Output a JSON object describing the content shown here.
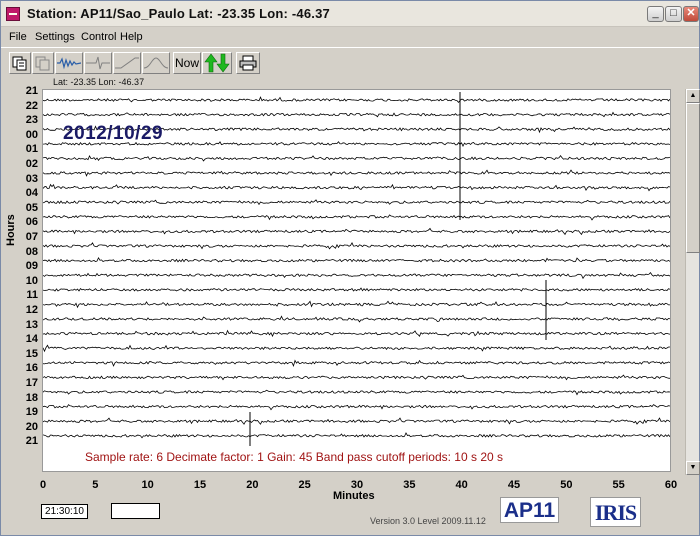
{
  "window": {
    "title": "Station: AP11/Sao_Paulo Lat: -23.35 Lon: -46.37",
    "min_symbol": "_",
    "max_symbol": "□",
    "close_symbol": "✕"
  },
  "menu": [
    "File",
    "Settings",
    "Control",
    "Help"
  ],
  "toolbar": {
    "buttons": [
      {
        "name": "copy-icon"
      },
      {
        "name": "paste-icon"
      },
      {
        "name": "waveform-icon"
      },
      {
        "name": "spike-icon"
      },
      {
        "name": "ramp-icon"
      },
      {
        "name": "filter-curve-icon"
      },
      {
        "name": "now",
        "label": "Now"
      },
      {
        "name": "scroll-arrows-icon"
      },
      {
        "name": "print-icon"
      }
    ]
  },
  "plot": {
    "latlon": "Lat: -23.35 Lon: -46.37",
    "date": "2012/10/29",
    "hour_axis_label": "Hours",
    "hours": [
      "21",
      "22",
      "23",
      "00",
      "01",
      "02",
      "03",
      "04",
      "05",
      "06",
      "07",
      "08",
      "09",
      "10",
      "11",
      "12",
      "13",
      "14",
      "15",
      "16",
      "17",
      "18",
      "19",
      "20",
      "21"
    ],
    "info": "Sample rate: 6  Decimate factor: 1  Gain: 45  Band pass cutoff periods: 10 s 20 s",
    "minutes_axis_label": "Minutes",
    "minute_ticks": [
      "0",
      "5",
      "10",
      "15",
      "20",
      "25",
      "30",
      "35",
      "40",
      "45",
      "50",
      "55",
      "60"
    ],
    "trace_color": "#000000",
    "info_color": "#a01414"
  },
  "status": {
    "time": "21:30:10",
    "version": "Version 3.0 Level 2009.11.12",
    "station": "AP11",
    "logo": "IRIS"
  }
}
